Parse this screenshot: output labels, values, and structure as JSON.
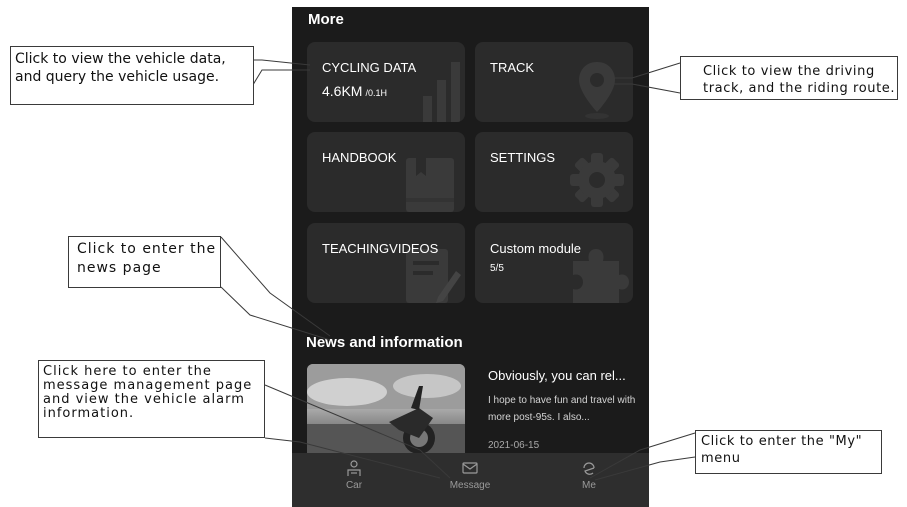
{
  "more": {
    "title": "More",
    "tiles": [
      {
        "label": "CYCLING DATA",
        "value_main": "4.6KM",
        "value_sub": "/0.1H"
      },
      {
        "label": "TRACK"
      },
      {
        "label": "HANDBOOK"
      },
      {
        "label": "SETTINGS"
      },
      {
        "label": "TEACHINGVIDEOS"
      },
      {
        "label": "Custom module",
        "sub": "5/5"
      }
    ]
  },
  "news": {
    "title": "News and information",
    "item": {
      "title": "Obviously, you can rel...",
      "snippet": "I hope to have fun and travel with more post-95s. I also...",
      "date": "2021-06-15"
    }
  },
  "tabbar": {
    "tabs": [
      {
        "label": "Car",
        "icon": "car-icon"
      },
      {
        "label": "Message",
        "icon": "mail-icon"
      },
      {
        "label": "Me",
        "icon": "me-icon"
      }
    ]
  },
  "callouts": {
    "vehicle_data": "Click to view the vehicle data, and query the vehicle usage.",
    "track": "Click to view the driving track, and the riding route.",
    "news": "Click to enter the news page",
    "message": "Click here to enter the message management page and view the vehicle alarm information.",
    "my_menu": "Click to enter the \"My\" menu"
  },
  "colors": {
    "background": "#1b1b1b",
    "tile": "#2b2b2b",
    "tabbar": "#2e2e2e"
  }
}
